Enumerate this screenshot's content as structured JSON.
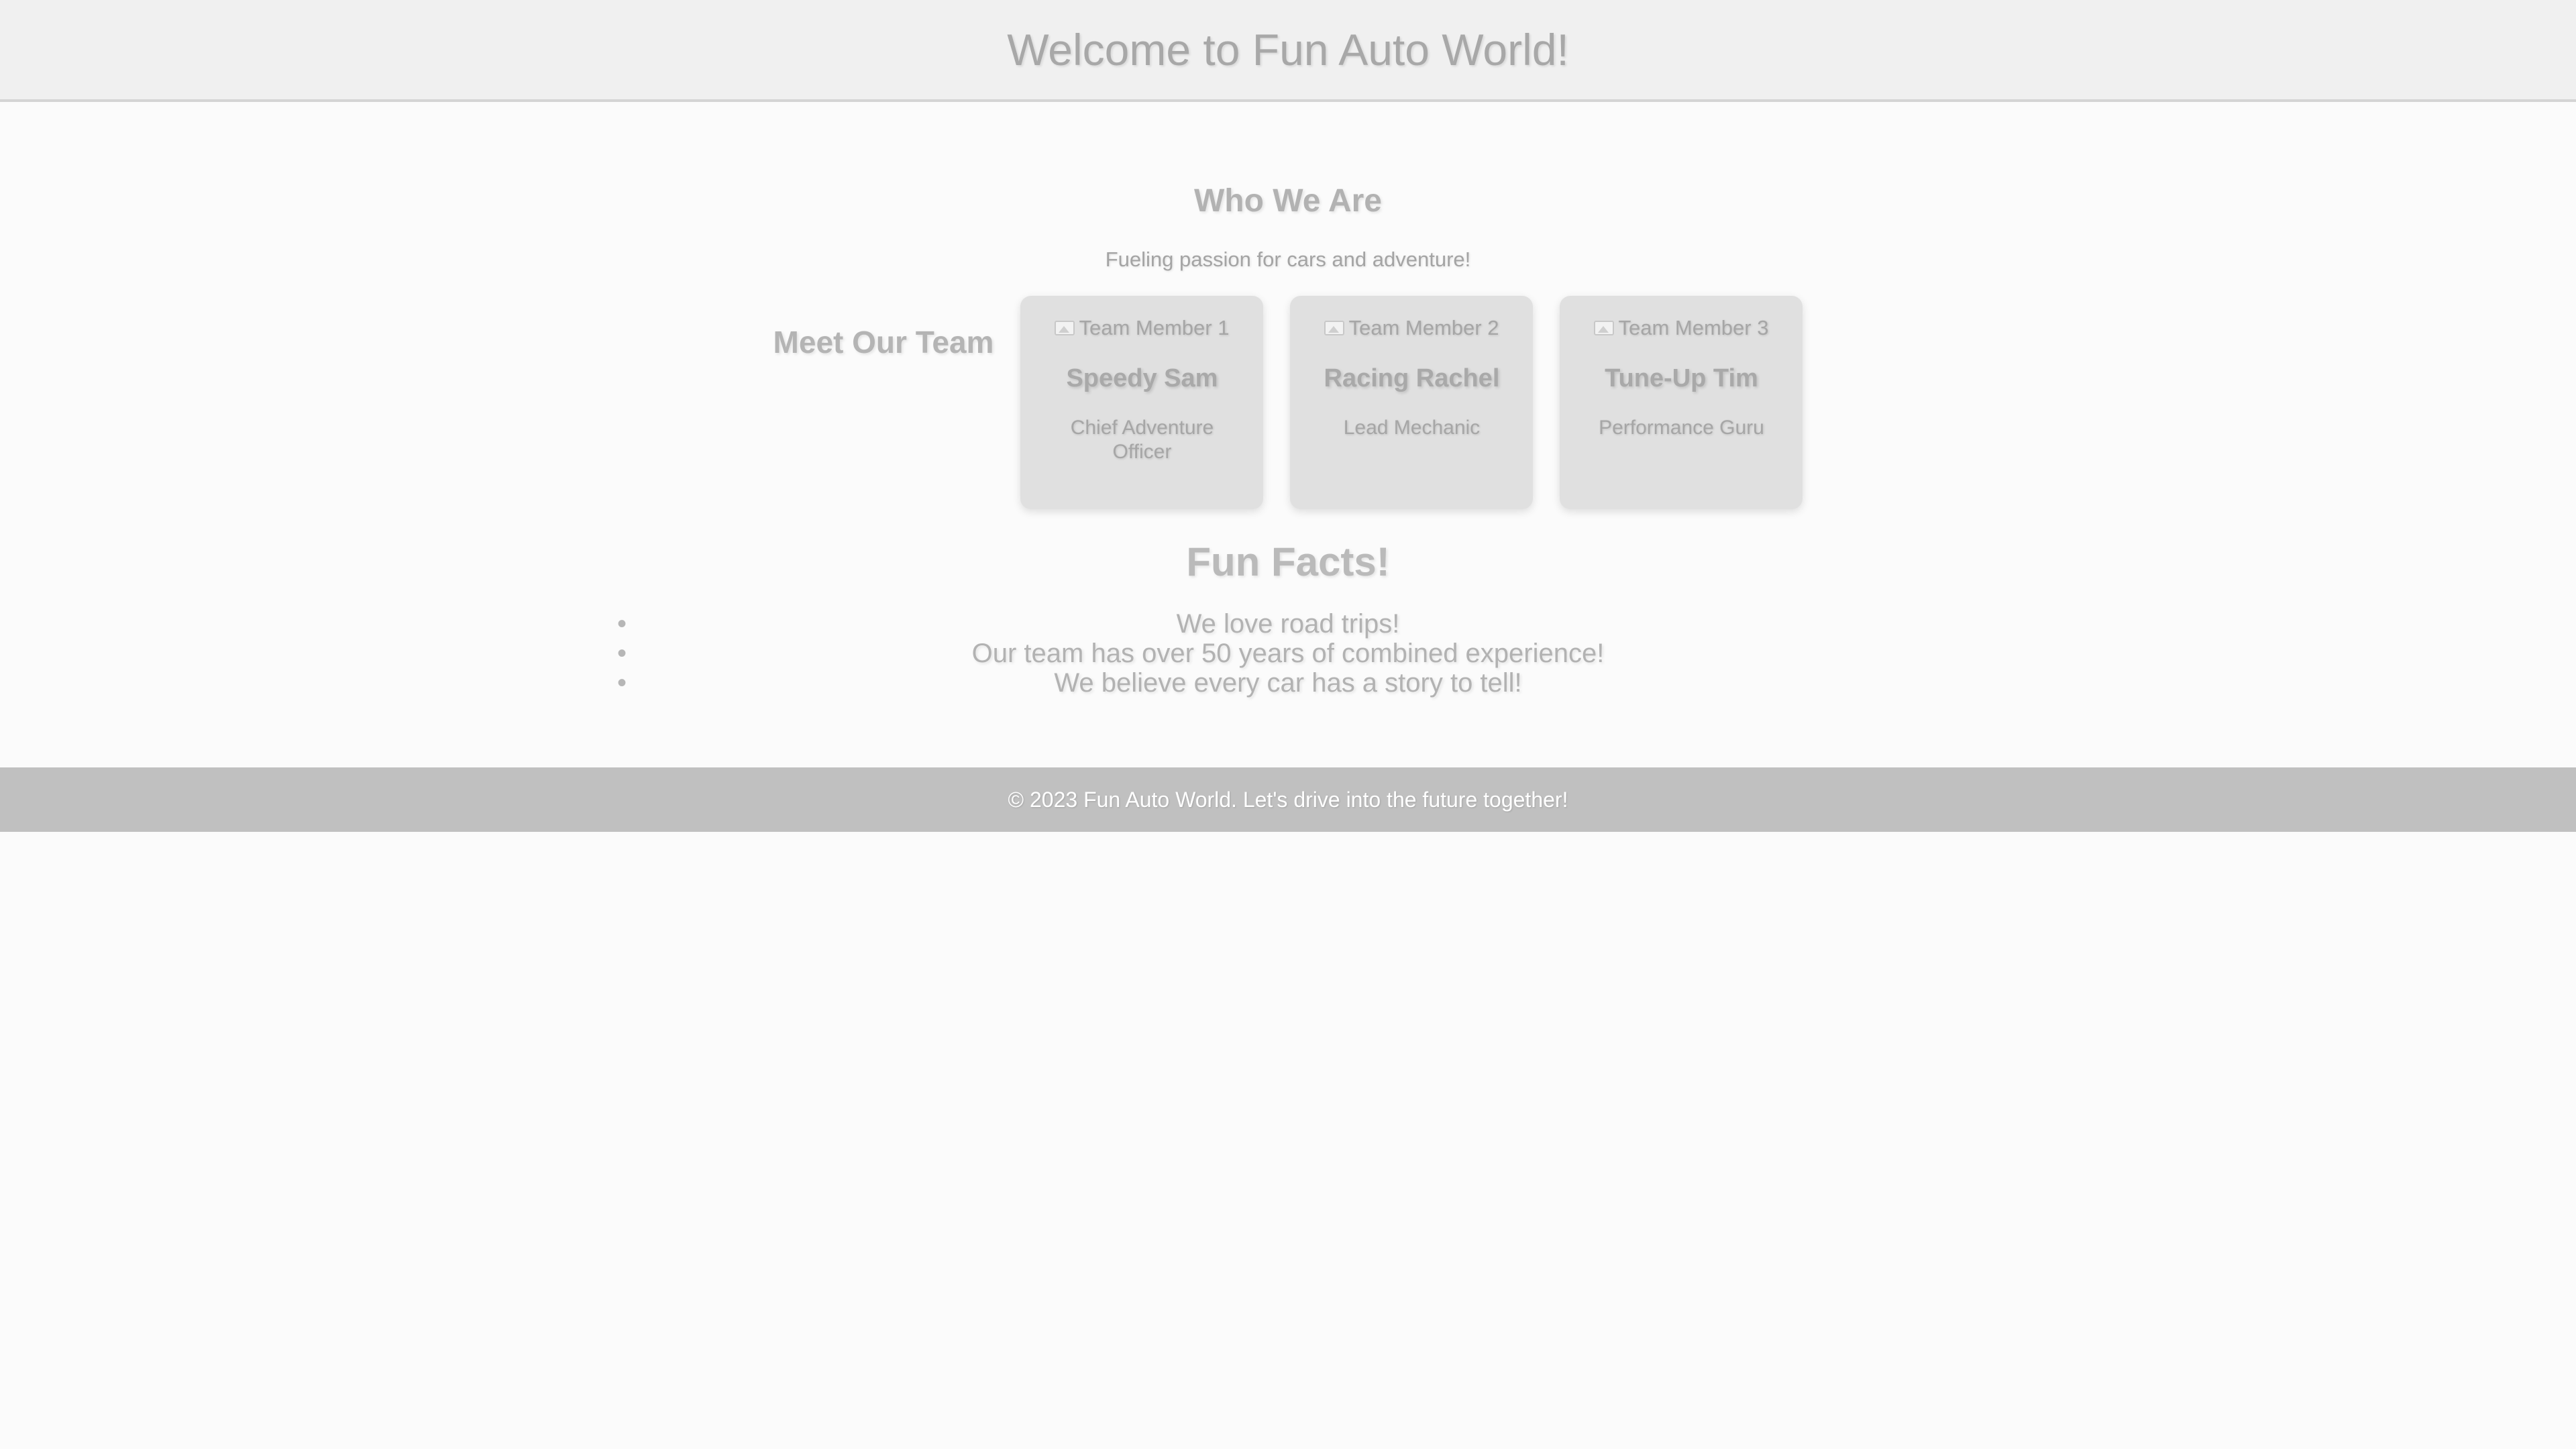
{
  "header": {
    "title": "Welcome to Fun Auto World!"
  },
  "about": {
    "title": "Who We Are",
    "tagline": "Fueling passion for cars and adventure!"
  },
  "team": {
    "title": "Meet Our Team",
    "members": [
      {
        "image_alt": "Team Member 1",
        "name": "Speedy Sam",
        "role": "Chief Adventure Officer"
      },
      {
        "image_alt": "Team Member 2",
        "name": "Racing Rachel",
        "role": "Lead Mechanic"
      },
      {
        "image_alt": "Team Member 3",
        "name": "Tune-Up Tim",
        "role": "Performance Guru"
      }
    ]
  },
  "facts": {
    "title": "Fun Facts!",
    "items": [
      "We love road trips!",
      "Our team has over 50 years of combined experience!",
      "We believe every car has a story to tell!"
    ]
  },
  "footer": {
    "text": "© 2023 Fun Auto World. Let's drive into the future together!"
  },
  "colors": {
    "header_bg": "#f0f0f0",
    "card_bg": "#e0e0e0",
    "footer_bg": "#c0c0c0",
    "footer_text": "#ffffff"
  }
}
